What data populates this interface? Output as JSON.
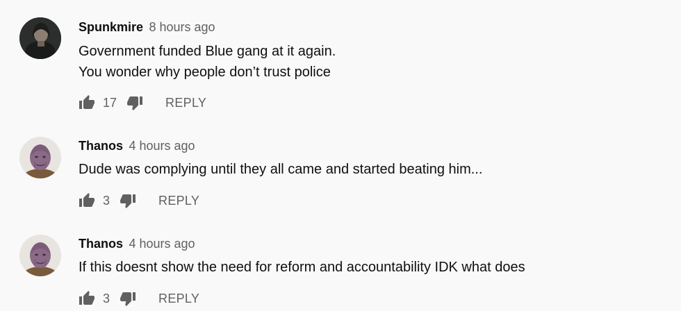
{
  "comments": [
    {
      "author": "Spunkmire",
      "time": "8 hours ago",
      "lines": [
        "Government funded Blue gang at it again.",
        "You wonder why people don’t trust police"
      ],
      "likes": "17",
      "reply_label": "REPLY",
      "avatar": "dark-hooded-figure-avatar"
    },
    {
      "author": "Thanos",
      "time": "4 hours ago",
      "lines": [
        "Dude was complying until they all came and started beating him..."
      ],
      "likes": "3",
      "reply_label": "REPLY",
      "avatar": "thanos-face-avatar"
    },
    {
      "author": "Thanos",
      "time": "4 hours ago",
      "lines": [
        "If this doesnt show the need for reform and accountability IDK what does"
      ],
      "likes": "3",
      "reply_label": "REPLY",
      "avatar": "thanos-face-avatar"
    }
  ],
  "colors": {
    "background": "#f9f9f9",
    "text": "#0f0f0f",
    "secondary": "#606060"
  }
}
